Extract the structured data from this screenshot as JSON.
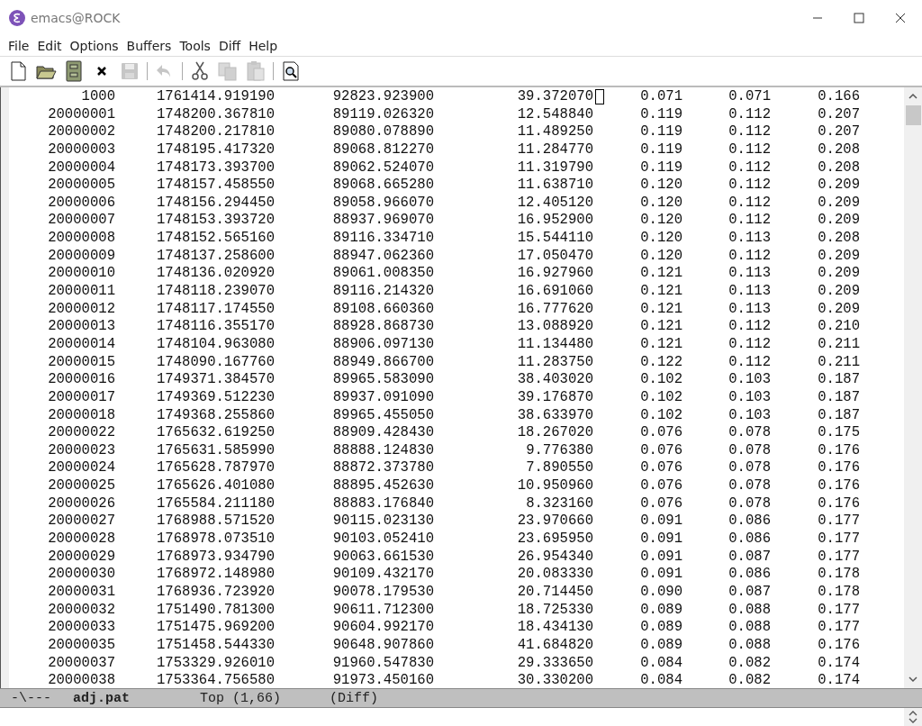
{
  "window": {
    "title": "emacs@ROCK"
  },
  "menu": [
    "File",
    "Edit",
    "Options",
    "Buffers",
    "Tools",
    "Diff",
    "Help"
  ],
  "toolbar": [
    {
      "kind": "new",
      "disabled": false
    },
    {
      "kind": "open",
      "disabled": false
    },
    {
      "kind": "dired",
      "disabled": false
    },
    {
      "kind": "close",
      "disabled": false
    },
    {
      "kind": "save",
      "disabled": true
    },
    {
      "kind": "sep"
    },
    {
      "kind": "undo",
      "disabled": true
    },
    {
      "kind": "sep"
    },
    {
      "kind": "cut",
      "disabled": false
    },
    {
      "kind": "copy",
      "disabled": true
    },
    {
      "kind": "paste",
      "disabled": true
    },
    {
      "kind": "sep"
    },
    {
      "kind": "search",
      "disabled": false
    }
  ],
  "buffer": {
    "rows": [
      {
        "cells": [
          "1000",
          "1761414.919190",
          "92823.923900",
          "39.372070",
          "0.071",
          "0.071",
          "0.166"
        ],
        "cursor": true
      },
      {
        "cells": [
          "20000001",
          "1748200.367810",
          "89119.026320",
          "12.548840",
          "0.119",
          "0.112",
          "0.207"
        ],
        "cursor": false
      },
      {
        "cells": [
          "20000002",
          "1748200.217810",
          "89080.078890",
          "11.489250",
          "0.119",
          "0.112",
          "0.207"
        ],
        "cursor": false
      },
      {
        "cells": [
          "20000003",
          "1748195.417320",
          "89068.812270",
          "11.284770",
          "0.119",
          "0.112",
          "0.208"
        ],
        "cursor": false
      },
      {
        "cells": [
          "20000004",
          "1748173.393700",
          "89062.524070",
          "11.319790",
          "0.119",
          "0.112",
          "0.208"
        ],
        "cursor": false
      },
      {
        "cells": [
          "20000005",
          "1748157.458550",
          "89068.665280",
          "11.638710",
          "0.120",
          "0.112",
          "0.209"
        ],
        "cursor": false
      },
      {
        "cells": [
          "20000006",
          "1748156.294450",
          "89058.966070",
          "12.405120",
          "0.120",
          "0.112",
          "0.209"
        ],
        "cursor": false
      },
      {
        "cells": [
          "20000007",
          "1748153.393720",
          "88937.969070",
          "16.952900",
          "0.120",
          "0.112",
          "0.209"
        ],
        "cursor": false
      },
      {
        "cells": [
          "20000008",
          "1748152.565160",
          "89116.334710",
          "15.544110",
          "0.120",
          "0.113",
          "0.208"
        ],
        "cursor": false
      },
      {
        "cells": [
          "20000009",
          "1748137.258600",
          "88947.062360",
          "17.050470",
          "0.120",
          "0.112",
          "0.209"
        ],
        "cursor": false
      },
      {
        "cells": [
          "20000010",
          "1748136.020920",
          "89061.008350",
          "16.927960",
          "0.121",
          "0.113",
          "0.209"
        ],
        "cursor": false
      },
      {
        "cells": [
          "20000011",
          "1748118.239070",
          "89116.214320",
          "16.691060",
          "0.121",
          "0.113",
          "0.209"
        ],
        "cursor": false
      },
      {
        "cells": [
          "20000012",
          "1748117.174550",
          "89108.660360",
          "16.777620",
          "0.121",
          "0.113",
          "0.209"
        ],
        "cursor": false
      },
      {
        "cells": [
          "20000013",
          "1748116.355170",
          "88928.868730",
          "13.088920",
          "0.121",
          "0.112",
          "0.210"
        ],
        "cursor": false
      },
      {
        "cells": [
          "20000014",
          "1748104.963080",
          "88906.097130",
          "11.134480",
          "0.121",
          "0.112",
          "0.211"
        ],
        "cursor": false
      },
      {
        "cells": [
          "20000015",
          "1748090.167760",
          "88949.866700",
          "11.283750",
          "0.122",
          "0.112",
          "0.211"
        ],
        "cursor": false
      },
      {
        "cells": [
          "20000016",
          "1749371.384570",
          "89965.583090",
          "38.403020",
          "0.102",
          "0.103",
          "0.187"
        ],
        "cursor": false
      },
      {
        "cells": [
          "20000017",
          "1749369.512230",
          "89937.091090",
          "39.176870",
          "0.102",
          "0.103",
          "0.187"
        ],
        "cursor": false
      },
      {
        "cells": [
          "20000018",
          "1749368.255860",
          "89965.455050",
          "38.633970",
          "0.102",
          "0.103",
          "0.187"
        ],
        "cursor": false
      },
      {
        "cells": [
          "20000022",
          "1765632.619250",
          "88909.428430",
          "18.267020",
          "0.076",
          "0.078",
          "0.175"
        ],
        "cursor": false
      },
      {
        "cells": [
          "20000023",
          "1765631.585990",
          "88888.124830",
          "9.776380",
          "0.076",
          "0.078",
          "0.176"
        ],
        "cursor": false
      },
      {
        "cells": [
          "20000024",
          "1765628.787970",
          "88872.373780",
          "7.890550",
          "0.076",
          "0.078",
          "0.176"
        ],
        "cursor": false
      },
      {
        "cells": [
          "20000025",
          "1765626.401080",
          "88895.452630",
          "10.950960",
          "0.076",
          "0.078",
          "0.176"
        ],
        "cursor": false
      },
      {
        "cells": [
          "20000026",
          "1765584.211180",
          "88883.176840",
          "8.323160",
          "0.076",
          "0.078",
          "0.176"
        ],
        "cursor": false
      },
      {
        "cells": [
          "20000027",
          "1768988.571520",
          "90115.023130",
          "23.970660",
          "0.091",
          "0.086",
          "0.177"
        ],
        "cursor": false
      },
      {
        "cells": [
          "20000028",
          "1768978.073510",
          "90103.052410",
          "23.695950",
          "0.091",
          "0.086",
          "0.177"
        ],
        "cursor": false
      },
      {
        "cells": [
          "20000029",
          "1768973.934790",
          "90063.661530",
          "26.954340",
          "0.091",
          "0.087",
          "0.177"
        ],
        "cursor": false
      },
      {
        "cells": [
          "20000030",
          "1768972.148980",
          "90109.432170",
          "20.083330",
          "0.091",
          "0.086",
          "0.178"
        ],
        "cursor": false
      },
      {
        "cells": [
          "20000031",
          "1768936.723920",
          "90078.179530",
          "20.714450",
          "0.090",
          "0.087",
          "0.178"
        ],
        "cursor": false
      },
      {
        "cells": [
          "20000032",
          "1751490.781300",
          "90611.712300",
          "18.725330",
          "0.089",
          "0.088",
          "0.177"
        ],
        "cursor": false
      },
      {
        "cells": [
          "20000033",
          "1751475.969200",
          "90604.992170",
          "18.434130",
          "0.089",
          "0.088",
          "0.177"
        ],
        "cursor": false
      },
      {
        "cells": [
          "20000035",
          "1751458.544330",
          "90648.907860",
          "41.684820",
          "0.089",
          "0.088",
          "0.176"
        ],
        "cursor": false
      },
      {
        "cells": [
          "20000037",
          "1753329.926010",
          "91960.547830",
          "29.333650",
          "0.084",
          "0.082",
          "0.174"
        ],
        "cursor": false
      },
      {
        "cells": [
          "20000038",
          "1753364.756580",
          "91973.450160",
          "30.330200",
          "0.084",
          "0.082",
          "0.174"
        ],
        "cursor": false
      }
    ]
  },
  "mode_line": {
    "status": "-\\---",
    "buffer_name": "adj.pat",
    "position": "Top (1,66)",
    "mode": "(Diff)"
  }
}
